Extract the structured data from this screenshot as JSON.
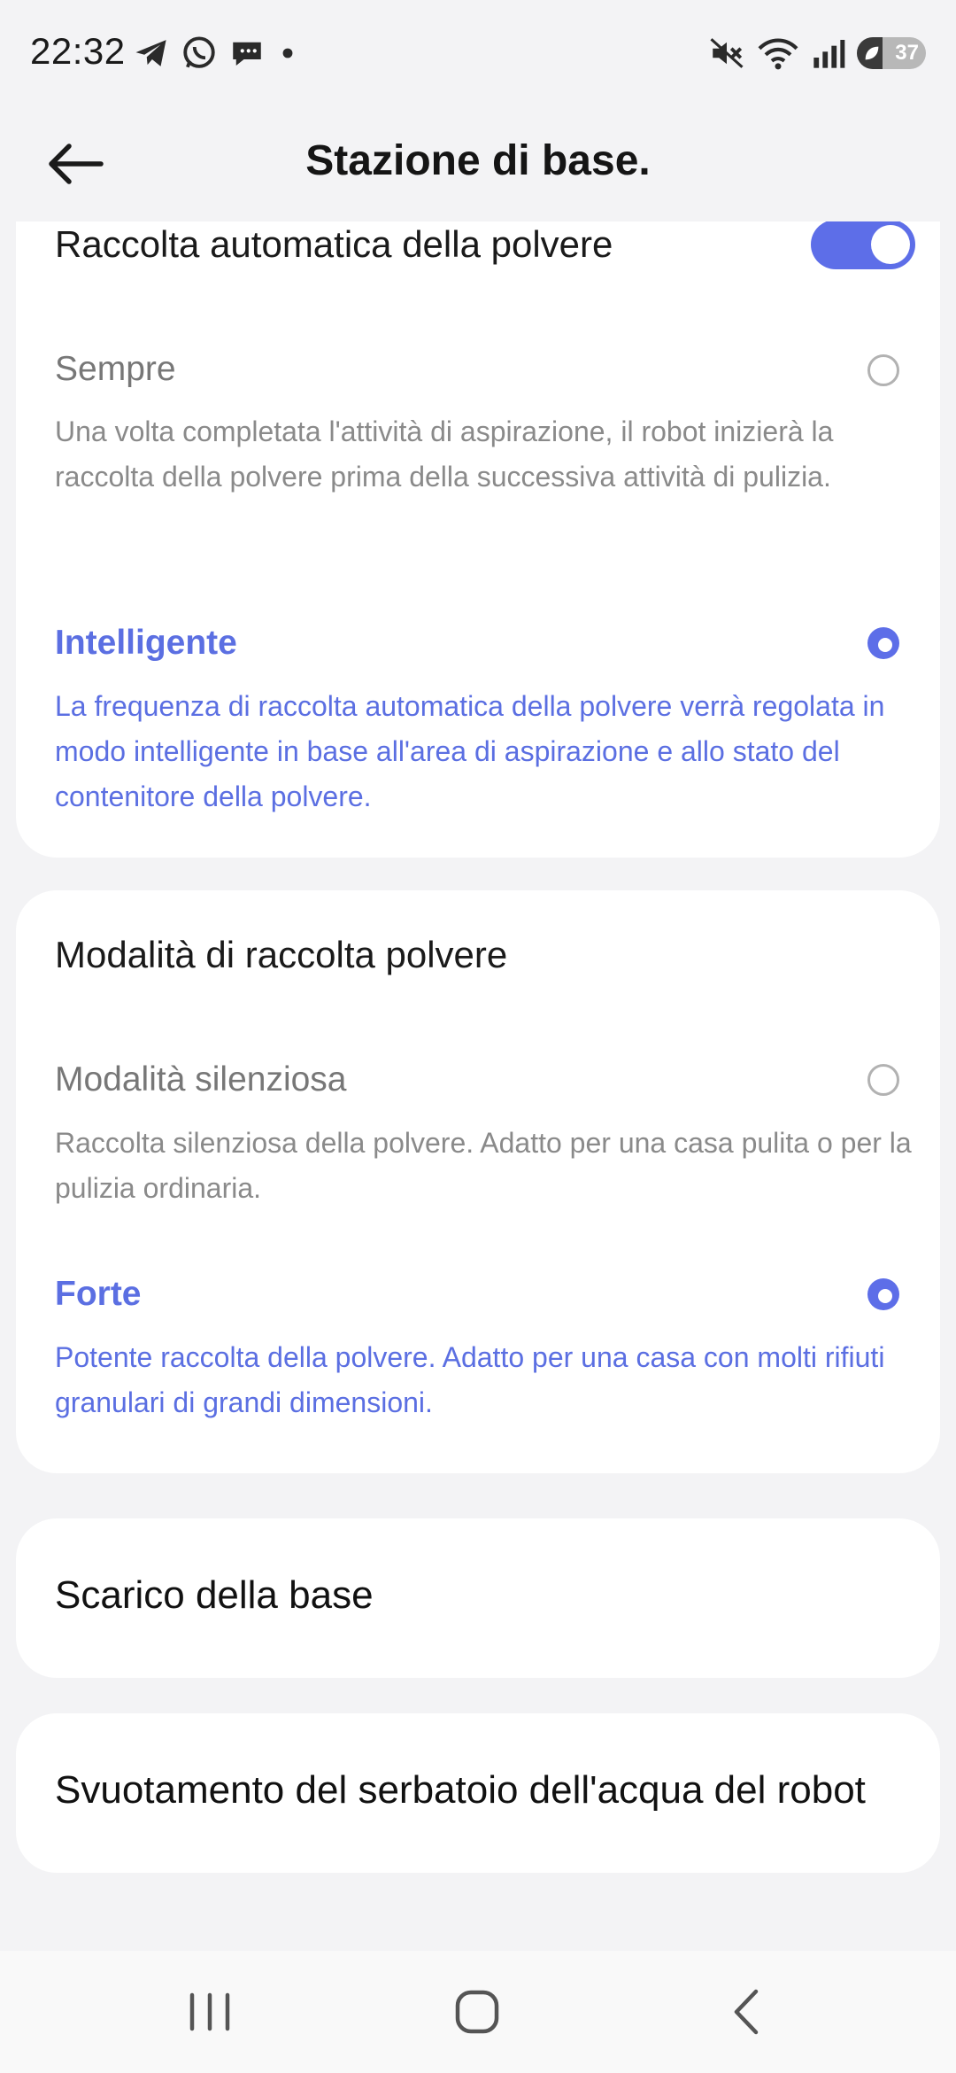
{
  "status_bar": {
    "time": "22:32",
    "left_icons": [
      "telegram-icon",
      "whatsapp-icon",
      "chat-bubble-icon",
      "dot-icon"
    ],
    "right_icons": [
      "mute-icon",
      "wifi-icon",
      "signal-icon"
    ],
    "battery_level": "37",
    "battery_fraction": 0.37
  },
  "header": {
    "title": "Stazione di base.",
    "back_icon": "arrow-left-icon"
  },
  "auto_dust": {
    "title": "Raccolta automatica della polvere",
    "toggle_on": true,
    "options": [
      {
        "label": "Sempre",
        "description": "Una volta completata l'attività di aspirazione, il robot inizierà la raccolta della polvere prima della successiva attività di pulizia.",
        "selected": false
      },
      {
        "label": "Intelligente",
        "description": "La frequenza di raccolta automatica della polvere verrà regolata in modo intelligente in base all'area di aspirazione e allo stato del contenitore della polvere.",
        "selected": true
      }
    ]
  },
  "dust_mode": {
    "title": "Modalità di raccolta polvere",
    "options": [
      {
        "label": "Modalità silenziosa",
        "description": "Raccolta silenziosa della polvere. Adatto per una casa pulita o per la pulizia ordinaria.",
        "selected": false
      },
      {
        "label": "Forte",
        "description": "Potente raccolta della polvere. Adatto per una casa con molti rifiuti granulari di grandi dimensioni.",
        "selected": true
      }
    ]
  },
  "items": {
    "base_drain": "Scarico della base",
    "robot_tank": "Svuotamento del serbatoio dell'acqua del robot"
  },
  "colors": {
    "accent": "#5d6ee8",
    "background": "#f3f3f5",
    "card": "#ffffff"
  },
  "nav_bar": {
    "icons": [
      "recent-apps-icon",
      "home-icon",
      "back-icon"
    ]
  }
}
